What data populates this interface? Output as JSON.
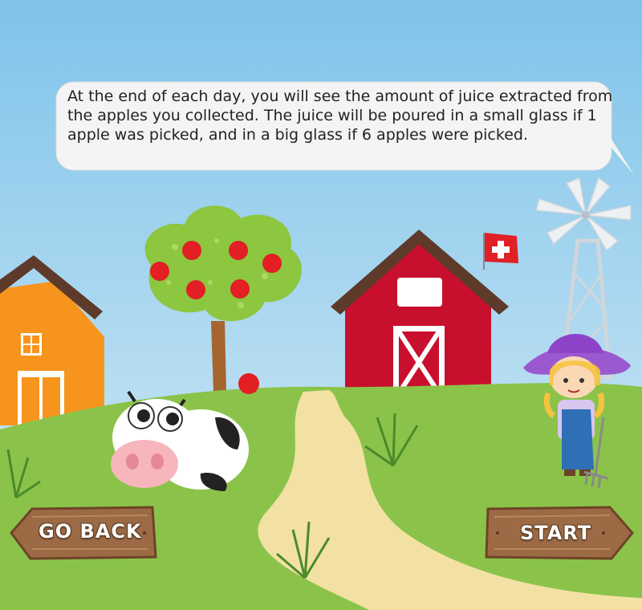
{
  "instruction": {
    "text": "At the end of each day, you will see the amount of juice extracted from the apples you collected. The juice will be poured in a small glass if 1 apple was picked, and in a big glass if 6 apples were picked."
  },
  "buttons": {
    "go_back_label": "GO BACK",
    "start_label": "START"
  },
  "colors": {
    "sky": "#b9dcee",
    "grass": "#8bc34a",
    "path": "#f3e1a3",
    "barn_red": "#c8102e",
    "house_orange": "#f7941d",
    "sign_wood": "#9c6b46",
    "cow_pink": "#f7b6bc"
  },
  "icons": {
    "tree": "apple-tree-icon",
    "barn": "barn-icon",
    "house": "farm-house-icon",
    "windmill": "windmill-icon",
    "cow": "cow-icon",
    "farmer": "farmer-girl-icon",
    "flag": "swiss-flag-icon",
    "apple": "apple-icon"
  }
}
